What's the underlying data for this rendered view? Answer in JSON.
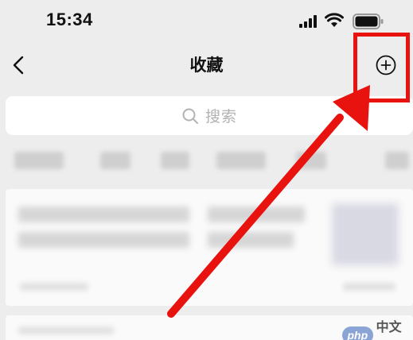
{
  "status_bar": {
    "time": "15:34",
    "icons": [
      "signal-icon",
      "wifi-icon",
      "battery-icon"
    ]
  },
  "nav": {
    "back_icon": "chevron-left-icon",
    "title": "收藏",
    "add_icon": "plus-circle-icon"
  },
  "search": {
    "icon": "search-icon",
    "placeholder": "搜索"
  },
  "annotation": {
    "color": "#e8120f"
  },
  "watermark": {
    "badge": "php",
    "text": "中文网"
  }
}
